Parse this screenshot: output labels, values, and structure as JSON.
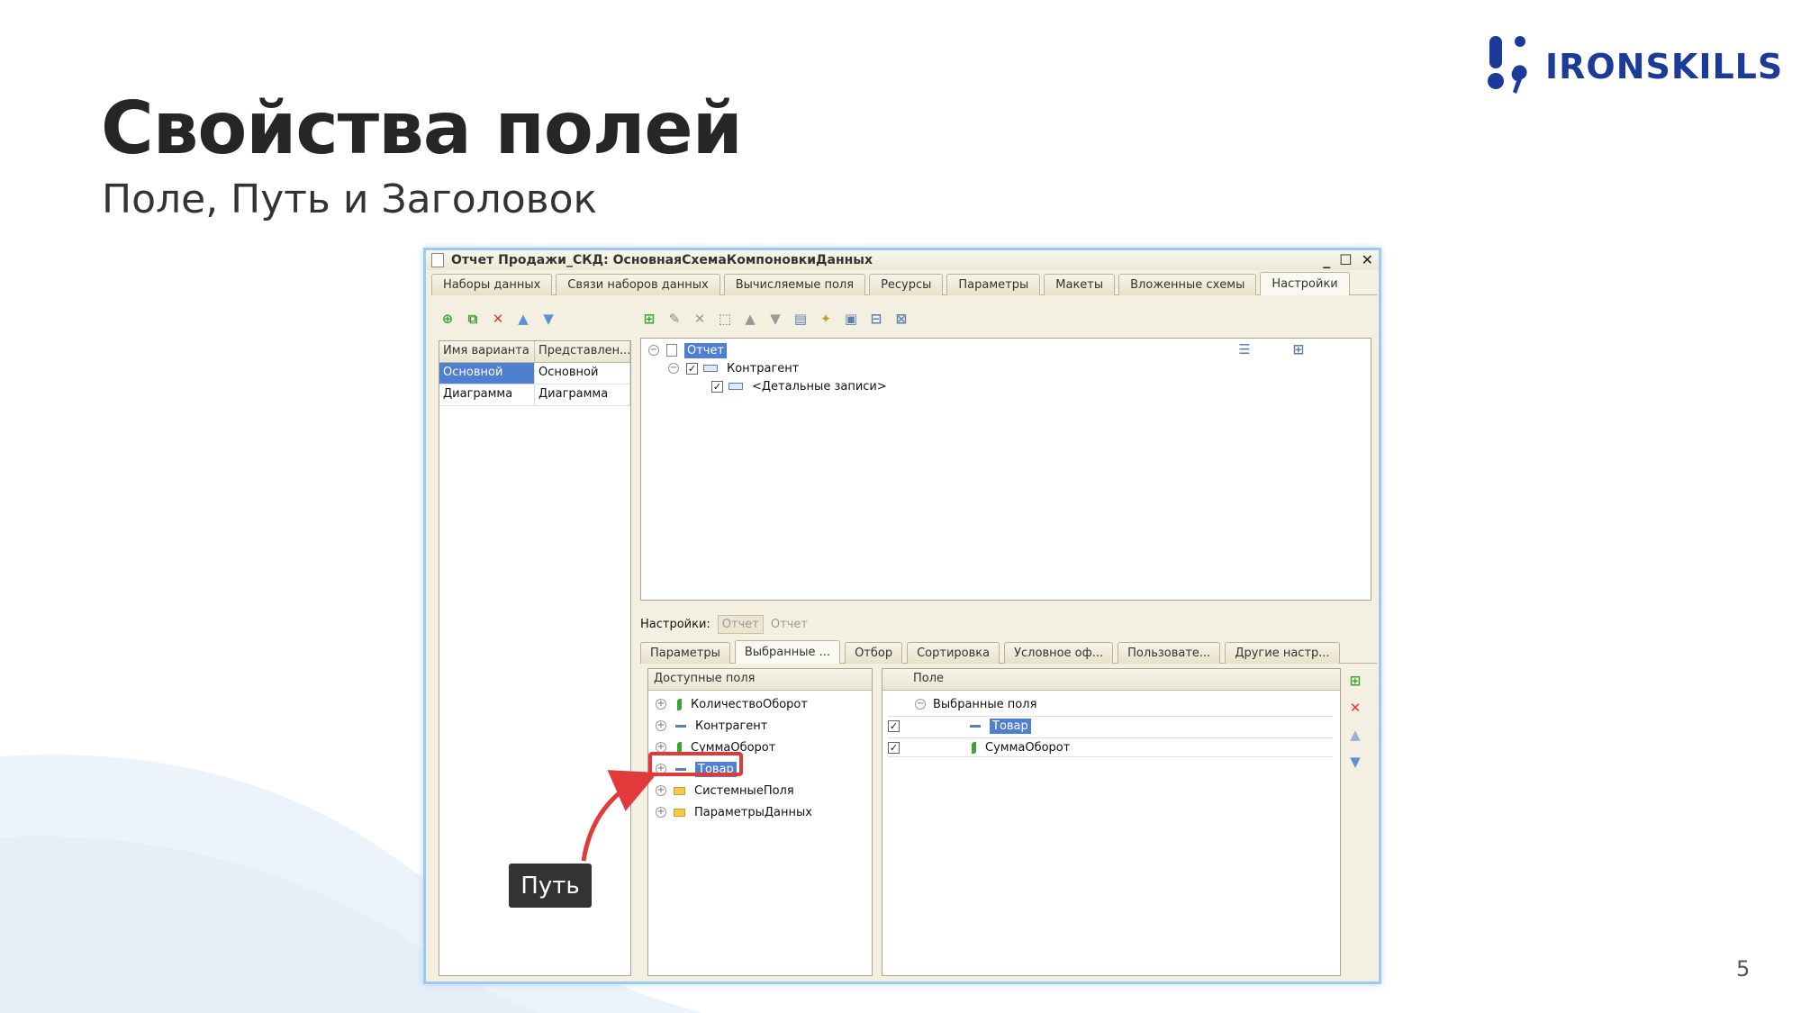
{
  "slide": {
    "title": "Свойства полей",
    "subtitle": "Поле, Путь и Заголовок",
    "page_number": "5",
    "logo_text": "IRONSKILLS",
    "callout": "Путь"
  },
  "colors": {
    "brand": "#1b3a9a",
    "highlight": "#4f7fd0",
    "callout_box": "#e23a3a",
    "callout_bg": "#333333"
  },
  "window": {
    "title": "Отчет Продажи_СКД: ОсновнаяСхемаКомпоновкиДанных",
    "tabs": [
      "Наборы данных",
      "Связи наборов данных",
      "Вычисляемые поля",
      "Ресурсы",
      "Параметры",
      "Макеты",
      "Вложенные схемы",
      "Настройки"
    ],
    "active_tab": "Настройки",
    "variants": {
      "headers": [
        "Имя варианта",
        "Представлен..."
      ],
      "rows": [
        [
          "Основной",
          "Основной"
        ],
        [
          "Диаграмма",
          "Диаграмма"
        ]
      ]
    },
    "structure": {
      "root": "Отчет",
      "group": "Контрагент",
      "detail": "<Детальные записи>"
    },
    "settings_label": "Настройки:",
    "settings_value": "Отчет",
    "settings_value2": "Отчет",
    "subtabs": [
      "Параметры",
      "Выбранные ...",
      "Отбор",
      "Сортировка",
      "Условное оф...",
      "Пользовате...",
      "Другие настр..."
    ],
    "active_subtab": "Выбранные ...",
    "available": {
      "header": "Доступные поля",
      "items": [
        {
          "label": "КоличествоОборот",
          "icon": "resource-icon"
        },
        {
          "label": "Контрагент",
          "icon": "dimension-icon"
        },
        {
          "label": "СуммаОборот",
          "icon": "resource-icon"
        },
        {
          "label": "Товар",
          "icon": "dimension-icon"
        },
        {
          "label": "СистемныеПоля",
          "icon": "folder-icon"
        },
        {
          "label": "ПараметрыДанных",
          "icon": "folder-icon"
        }
      ]
    },
    "selected": {
      "header": "Поле",
      "group": "Выбранные поля",
      "items": [
        "Товар",
        "СуммаОборот"
      ]
    }
  }
}
